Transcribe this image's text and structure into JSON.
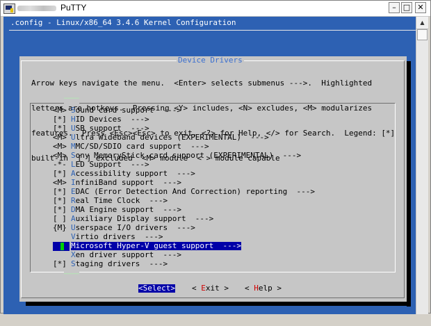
{
  "window": {
    "title": "PuTTY",
    "colors": {
      "terminal_bg": "#2d61b3",
      "dialog_bg": "#c6c6c6",
      "highlight": "#0000a8",
      "hotkey": "#2d61b3",
      "button_hotkey": "#d00000"
    }
  },
  "terminal": {
    "header": ".config - Linux/x86_64 3.4.6 Kernel Configuration"
  },
  "dialog": {
    "title": "Device Drivers",
    "help_lines": [
      "Arrow keys navigate the menu.  <Enter> selects submenus --->.  Highlighted",
      "letters are hotkeys.  Pressing <Y> includes, <N> excludes, <M> modularizes",
      "features.  Press <Esc><Esc> to exit, <?> for Help, </> for Search.  Legend: [*]",
      "built-in  [ ] excluded  <M> module  < > module capable"
    ],
    "menu": [
      {
        "mark": "<M>",
        "hotkey": "S",
        "rest": "ound card support  --->"
      },
      {
        "mark": "[*]",
        "hotkey": "H",
        "rest": "ID Devices  --->"
      },
      {
        "mark": "[*]",
        "hotkey": "U",
        "rest": "SB support  --->"
      },
      {
        "mark": "<M>",
        "hotkey": "U",
        "rest": "ltra Wideband devices (EXPERIMENTAL)  --->"
      },
      {
        "mark": "<M>",
        "hotkey": "M",
        "rest": "MC/SD/SDIO card support  --->"
      },
      {
        "mark": "<M>",
        "hotkey": "S",
        "rest": "ony MemoryStick card support (EXPERIMENTAL)  --->"
      },
      {
        "mark": "-*-",
        "hotkey": "L",
        "rest": "ED Support  --->"
      },
      {
        "mark": "[*]",
        "hotkey": "A",
        "rest": "ccessibility support  --->"
      },
      {
        "mark": "<M>",
        "hotkey": "I",
        "rest": "nfiniBand support  --->"
      },
      {
        "mark": "[*]",
        "hotkey": "E",
        "rest": "DAC (Error Detection And Correction) reporting  --->"
      },
      {
        "mark": "[*]",
        "hotkey": "R",
        "rest": "eal Time Clock  --->"
      },
      {
        "mark": "[*]",
        "hotkey": "D",
        "rest": "MA Engine support  --->"
      },
      {
        "mark": "[ ]",
        "hotkey": "A",
        "rest": "uxiliary Display support  --->"
      },
      {
        "mark": "{M}",
        "hotkey": "U",
        "rest": "serspace I/O drivers  --->"
      },
      {
        "mark": "",
        "hotkey": "V",
        "rest": "irtio drivers  --->"
      },
      {
        "mark": "",
        "hotkey": "M",
        "rest": "icrosoft Hyper-V guest support  --->"
      },
      {
        "mark": "",
        "hotkey": "X",
        "rest": "en driver support  --->"
      },
      {
        "mark": "[*]",
        "hotkey": "S",
        "rest": "taging drivers  --->"
      }
    ],
    "selected_index": 15,
    "buttons": [
      {
        "pre": "<",
        "hotkey": "S",
        "rest": "elect>"
      },
      {
        "pre": "< ",
        "hotkey": "E",
        "rest": "xit >"
      },
      {
        "pre": "< ",
        "hotkey": "H",
        "rest": "elp >"
      }
    ]
  }
}
